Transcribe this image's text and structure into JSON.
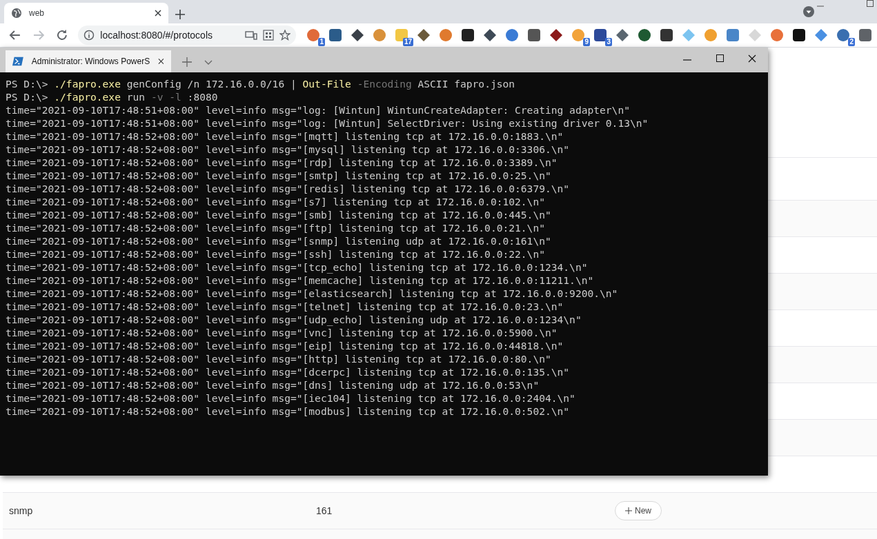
{
  "browser": {
    "tab": {
      "title": "web"
    },
    "address": "localhost:8080/#/protocols",
    "extensions": [
      {
        "color": "#e06a3a",
        "badge": "1"
      },
      {
        "color": "#2b5c8a"
      },
      {
        "color": "#3a4048"
      },
      {
        "color": "#d9913a"
      },
      {
        "color": "#f2c744",
        "badge": "17"
      },
      {
        "color": "#6b5a3a"
      },
      {
        "color": "#e07a2e"
      },
      {
        "color": "#202020"
      },
      {
        "color": "#3e4a56"
      },
      {
        "color": "#3a7bd5"
      },
      {
        "color": "#555555"
      },
      {
        "color": "#8b1a1a"
      },
      {
        "color": "#f2a33a",
        "badge": "9"
      },
      {
        "color": "#2d4a9a",
        "badge": "3"
      },
      {
        "color": "#5a6670"
      },
      {
        "color": "#1e5a32"
      },
      {
        "color": "#333333"
      },
      {
        "color": "#7cc4f0"
      },
      {
        "color": "#f0a030"
      },
      {
        "color": "#4a86c8"
      },
      {
        "color": "#d8d8d8"
      },
      {
        "color": "#e8703a"
      },
      {
        "color": "#111111"
      },
      {
        "color": "#4a90e2"
      },
      {
        "color": "#3a6fb0",
        "badge": "2"
      },
      {
        "color": "#5f6368"
      }
    ]
  },
  "terminal": {
    "tab": {
      "title": "Administrator: Windows PowerS"
    },
    "lines": [
      {
        "kind": "command",
        "segments": [
          {
            "text": "PS D:\\> ",
            "kind": "plain"
          },
          {
            "text": "./fapro.exe",
            "kind": "command"
          },
          {
            "text": " genConfig /n 172.16.0.0/16 | ",
            "kind": "plain"
          },
          {
            "text": "Out-File",
            "kind": "command"
          },
          {
            "text": " -Encoding",
            "kind": "parameter"
          },
          {
            "text": " ASCII fapro.json",
            "kind": "plain"
          }
        ]
      },
      {
        "kind": "command",
        "segments": [
          {
            "text": "PS D:\\> ",
            "kind": "plain"
          },
          {
            "text": "./fapro.exe",
            "kind": "command"
          },
          {
            "text": " run",
            "kind": "plain"
          },
          {
            "text": " -v -l",
            "kind": "parameter"
          },
          {
            "text": " :8080",
            "kind": "plain"
          }
        ]
      },
      {
        "kind": "output",
        "text": "time=\"2021-09-10T17:48:51+08:00\" level=info msg=\"log: [Wintun] WintunCreateAdapter: Creating adapter\\n\""
      },
      {
        "kind": "output",
        "text": "time=\"2021-09-10T17:48:51+08:00\" level=info msg=\"log: [Wintun] SelectDriver: Using existing driver 0.13\\n\""
      },
      {
        "kind": "output",
        "text": "time=\"2021-09-10T17:48:52+08:00\" level=info msg=\"[mqtt] listening tcp at 172.16.0.0:1883.\\n\""
      },
      {
        "kind": "output",
        "text": "time=\"2021-09-10T17:48:52+08:00\" level=info msg=\"[mysql] listening tcp at 172.16.0.0:3306.\\n\""
      },
      {
        "kind": "output",
        "text": "time=\"2021-09-10T17:48:52+08:00\" level=info msg=\"[rdp] listening tcp at 172.16.0.0:3389.\\n\""
      },
      {
        "kind": "output",
        "text": "time=\"2021-09-10T17:48:52+08:00\" level=info msg=\"[smtp] listening tcp at 172.16.0.0:25.\\n\""
      },
      {
        "kind": "output",
        "text": "time=\"2021-09-10T17:48:52+08:00\" level=info msg=\"[redis] listening tcp at 172.16.0.0:6379.\\n\""
      },
      {
        "kind": "output",
        "text": "time=\"2021-09-10T17:48:52+08:00\" level=info msg=\"[s7] listening tcp at 172.16.0.0:102.\\n\""
      },
      {
        "kind": "output",
        "text": "time=\"2021-09-10T17:48:52+08:00\" level=info msg=\"[smb] listening tcp at 172.16.0.0:445.\\n\""
      },
      {
        "kind": "output",
        "text": "time=\"2021-09-10T17:48:52+08:00\" level=info msg=\"[ftp] listening tcp at 172.16.0.0:21.\\n\""
      },
      {
        "kind": "output",
        "text": "time=\"2021-09-10T17:48:52+08:00\" level=info msg=\"[snmp] listening udp at 172.16.0.0:161\\n\""
      },
      {
        "kind": "output",
        "text": "time=\"2021-09-10T17:48:52+08:00\" level=info msg=\"[ssh] listening tcp at 172.16.0.0:22.\\n\""
      },
      {
        "kind": "output",
        "text": "time=\"2021-09-10T17:48:52+08:00\" level=info msg=\"[tcp_echo] listening tcp at 172.16.0.0:1234.\\n\""
      },
      {
        "kind": "output",
        "text": "time=\"2021-09-10T17:48:52+08:00\" level=info msg=\"[memcache] listening tcp at 172.16.0.0:11211.\\n\""
      },
      {
        "kind": "output",
        "text": "time=\"2021-09-10T17:48:52+08:00\" level=info msg=\"[elasticsearch] listening tcp at 172.16.0.0:9200.\\n\""
      },
      {
        "kind": "output",
        "text": "time=\"2021-09-10T17:48:52+08:00\" level=info msg=\"[telnet] listening tcp at 172.16.0.0:23.\\n\""
      },
      {
        "kind": "output",
        "text": "time=\"2021-09-10T17:48:52+08:00\" level=info msg=\"[udp_echo] listening udp at 172.16.0.0:1234\\n\""
      },
      {
        "kind": "output",
        "text": "time=\"2021-09-10T17:48:52+08:00\" level=info msg=\"[vnc] listening tcp at 172.16.0.0:5900.\\n\""
      },
      {
        "kind": "output",
        "text": "time=\"2021-09-10T17:48:52+08:00\" level=info msg=\"[eip] listening tcp at 172.16.0.0:44818.\\n\""
      },
      {
        "kind": "output",
        "text": "time=\"2021-09-10T17:48:52+08:00\" level=info msg=\"[http] listening tcp at 172.16.0.0:80.\\n\""
      },
      {
        "kind": "output",
        "text": "time=\"2021-09-10T17:48:52+08:00\" level=info msg=\"[dcerpc] listening tcp at 172.16.0.0:135.\\n\""
      },
      {
        "kind": "output",
        "text": "time=\"2021-09-10T17:48:52+08:00\" level=info msg=\"[dns] listening udp at 172.16.0.0:53\\n\""
      },
      {
        "kind": "output",
        "text": "time=\"2021-09-10T17:48:52+08:00\" level=info msg=\"[iec104] listening tcp at 172.16.0.0:2404.\\n\""
      },
      {
        "kind": "output",
        "text": "time=\"2021-09-10T17:48:52+08:00\" level=info msg=\"[modbus] listening tcp at 172.16.0.0:502.\\n\""
      }
    ]
  },
  "table": {
    "rows": [
      {
        "name": "snmp",
        "port": "161",
        "button": "New"
      }
    ]
  }
}
